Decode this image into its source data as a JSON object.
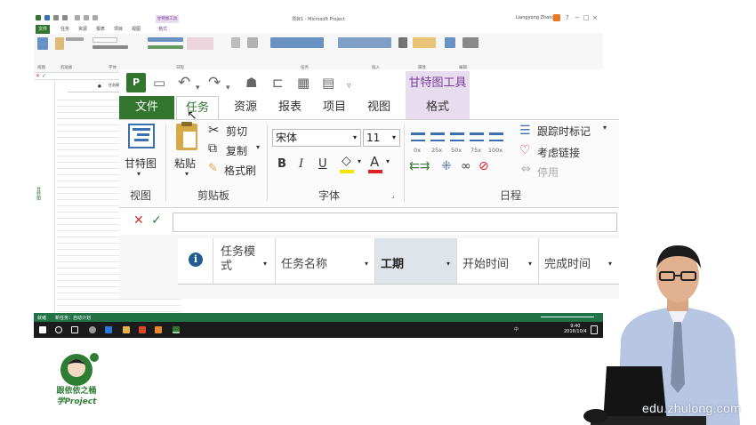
{
  "mini": {
    "title": "项目1 - Microsoft Project",
    "context_tab": "甘特图工具",
    "user": "Liangyong Zhang",
    "tabs": [
      "文件",
      "任务",
      "资源",
      "报表",
      "项目",
      "视图",
      "格式"
    ],
    "groups": [
      "视图",
      "剪贴板",
      "字体",
      "日程",
      "任务",
      "插入",
      "属性",
      "编辑"
    ],
    "column_info": "任务模式",
    "column_name": "任务名称",
    "left_label": "甘特图",
    "status_left": "就绪",
    "status_new_tasks": "新任务：自动计划",
    "clock_time": "9:40",
    "clock_date": "2016/10/4",
    "ime": "中"
  },
  "zoom": {
    "app_icon": "P",
    "context_tab": "甘特图工具",
    "tabs": {
      "file": "文件",
      "task": "任务",
      "resource": "资源",
      "report": "报表",
      "project": "项目",
      "view": "视图",
      "format": "格式"
    },
    "view_group": {
      "button": "甘特图",
      "label": "视图"
    },
    "clipboard": {
      "paste": "粘贴",
      "cut": "剪切",
      "copy": "复制",
      "format_painter": "格式刷",
      "label": "剪贴板"
    },
    "font": {
      "family": "宋体",
      "size": "11",
      "bold": "B",
      "italic": "I",
      "underline": "U",
      "label": "字体"
    },
    "schedule": {
      "percents": [
        "0x",
        "25x",
        "50x",
        "75x",
        "100x"
      ],
      "mark_on_track": "跟踪时标记",
      "respect_links": "考虑链接",
      "inactivate": "停用",
      "label": "日程"
    },
    "entry_bar": {
      "cancel": "✕",
      "confirm": "✓"
    },
    "columns": {
      "info": "i",
      "task_mode": "任务模式",
      "task_name": "任务名称",
      "duration": "工期",
      "start": "开始时间",
      "finish": "完成时间"
    }
  },
  "branding": {
    "logo_line1": "跟依依之桶",
    "logo_line2": "学Project",
    "watermark": "edu.zhulong.com"
  },
  "colors": {
    "project_green": "#31752f",
    "context_purple": "#e8dcef",
    "taskbar": "#1b1b1b",
    "status_green": "#217346"
  }
}
